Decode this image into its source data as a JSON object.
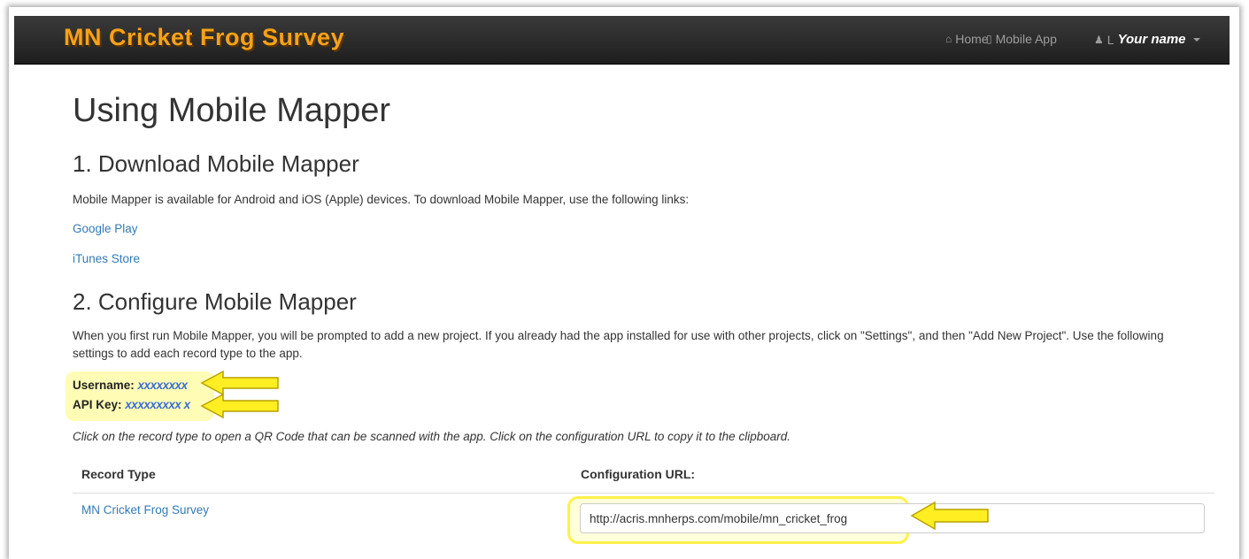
{
  "navbar": {
    "brand": "MN Cricket Frog Survey",
    "home_icon": "home-icon",
    "home_label": "Home",
    "mobile_icon": "mobile-icon",
    "mobile_label": "Mobile App",
    "user_icon": "user-icon",
    "user_prefix": "L",
    "user_name": "Your name"
  },
  "page": {
    "title": "Using Mobile Mapper",
    "section1_title": "1. Download Mobile Mapper",
    "section1_text": "Mobile Mapper is available for Android and iOS (Apple) devices. To download Mobile Mapper, use the following links:",
    "link_google_play": "Google Play",
    "link_itunes": "iTunes Store",
    "section2_title": "2. Configure Mobile Mapper",
    "section2_text": "When you first run Mobile Mapper, you will be prompted to add a new project. If you already had the app installed for use with other projects, click on \"Settings\", and then \"Add New Project\". Use the following settings to add each record type to the app.",
    "username_label": "Username:",
    "username_value": "xxxxxxxx",
    "apikey_label": "API Key:",
    "apikey_value": "xxxxxxxxx x",
    "instruction": "Click on the record type to open a QR Code that can be scanned with the app. Click on the configuration URL to copy it to the clipboard."
  },
  "table": {
    "col_record_type": "Record Type",
    "col_config_url": "Configuration URL:",
    "rows": [
      {
        "record_type": "MN Cricket Frog Survey",
        "config_url": "http://acris.mnherps.com/mobile/mn_cricket_frog"
      }
    ]
  },
  "colors": {
    "brand": "#f5a21a",
    "link": "#337ab7",
    "highlight": "#ffff66",
    "arrow": "#ffee22"
  }
}
